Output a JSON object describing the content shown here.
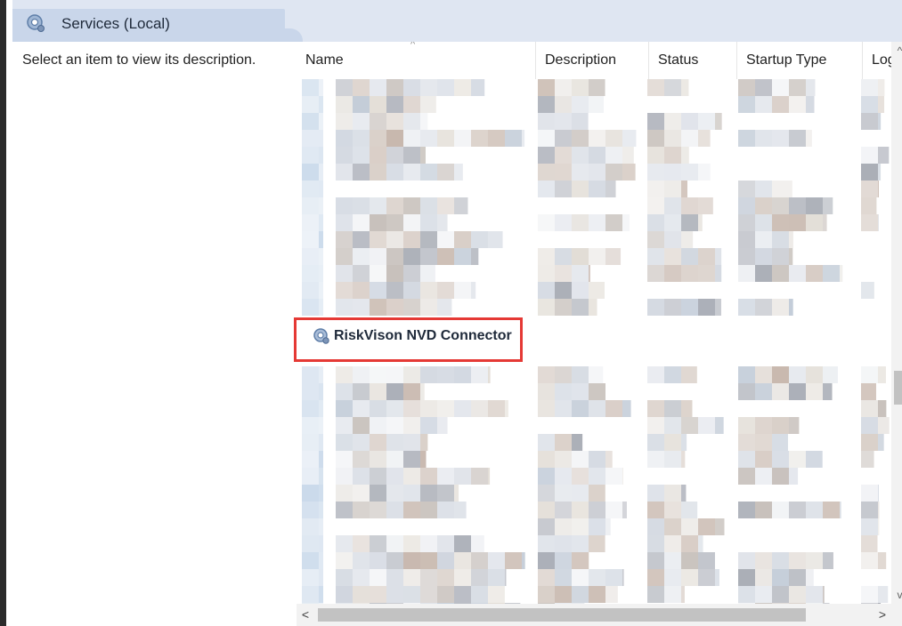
{
  "header": {
    "title": "Services (Local)",
    "icon": "services-gear-icon"
  },
  "description_pane": {
    "text": "Select an item to view its description."
  },
  "list": {
    "columns": [
      {
        "label": "Name"
      },
      {
        "label": "Description"
      },
      {
        "label": "Status"
      },
      {
        "label": "Startup Type"
      },
      {
        "label": "Log"
      }
    ],
    "sort_indicator": "^",
    "highlighted_service": {
      "name": "RiskVison NVD Connector",
      "icon": "service-gear-icon"
    }
  },
  "scrollbars": {
    "up": "^",
    "down": "v",
    "left": "<",
    "right": ">"
  },
  "colors": {
    "highlight_border": "#e53935",
    "header_band": "#dfe6f2",
    "header_tab": "#c9d6ea"
  }
}
